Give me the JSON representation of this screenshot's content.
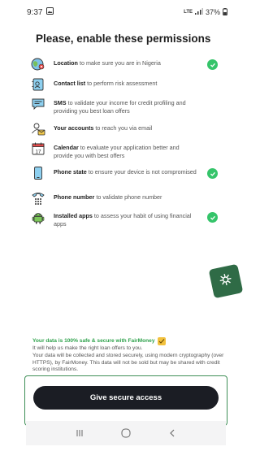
{
  "status_bar": {
    "time": "9:37",
    "network": "LTE",
    "battery": "37%"
  },
  "title": "Please, enable these permissions",
  "permissions": [
    {
      "bold": "Location",
      "text": " to make sure you are in  Nigeria",
      "icon": "globe-pin-icon",
      "granted": true
    },
    {
      "bold": "Contact list",
      "text": " to perform risk assessment",
      "icon": "contact-book-icon",
      "granted": false
    },
    {
      "bold": "SMS",
      "text": " to validate your income for credit profiling and providing you best loan offers",
      "icon": "sms-chat-icon",
      "granted": false
    },
    {
      "bold": "Your accounts",
      "text": " to reach you via email",
      "icon": "account-mail-icon",
      "granted": false
    },
    {
      "bold": "Calendar",
      "text": " to evaluate your application better and provide you with best offers",
      "icon": "calendar-icon",
      "granted": false
    },
    {
      "bold": "Phone state",
      "text": " to ensure your device is not compromised",
      "icon": "phone-device-icon",
      "granted": true
    },
    {
      "bold": "Phone number",
      "text": " to validate phone number",
      "icon": "dialpad-phone-icon",
      "granted": false
    },
    {
      "bold": "Installed apps",
      "text": " to assess your habit of using financial apps",
      "icon": "android-apps-icon",
      "granted": true
    }
  ],
  "safe": {
    "title": "Your data is 100% safe & secure with FairMoney",
    "line1": "It will help us make the right loan offers to you.",
    "line2": "Your data will be collected and stored securely, using modern cryptography (over HTTPS), by FairMoney. This data will not be sold but may be shared with credit scoring institutions."
  },
  "cta": {
    "label": "Give secure access"
  },
  "colors": {
    "accent_green": "#35c46a",
    "text_green": "#2fa24c",
    "button_dark": "#1b1d24",
    "bubble_green": "#2f6b46"
  }
}
